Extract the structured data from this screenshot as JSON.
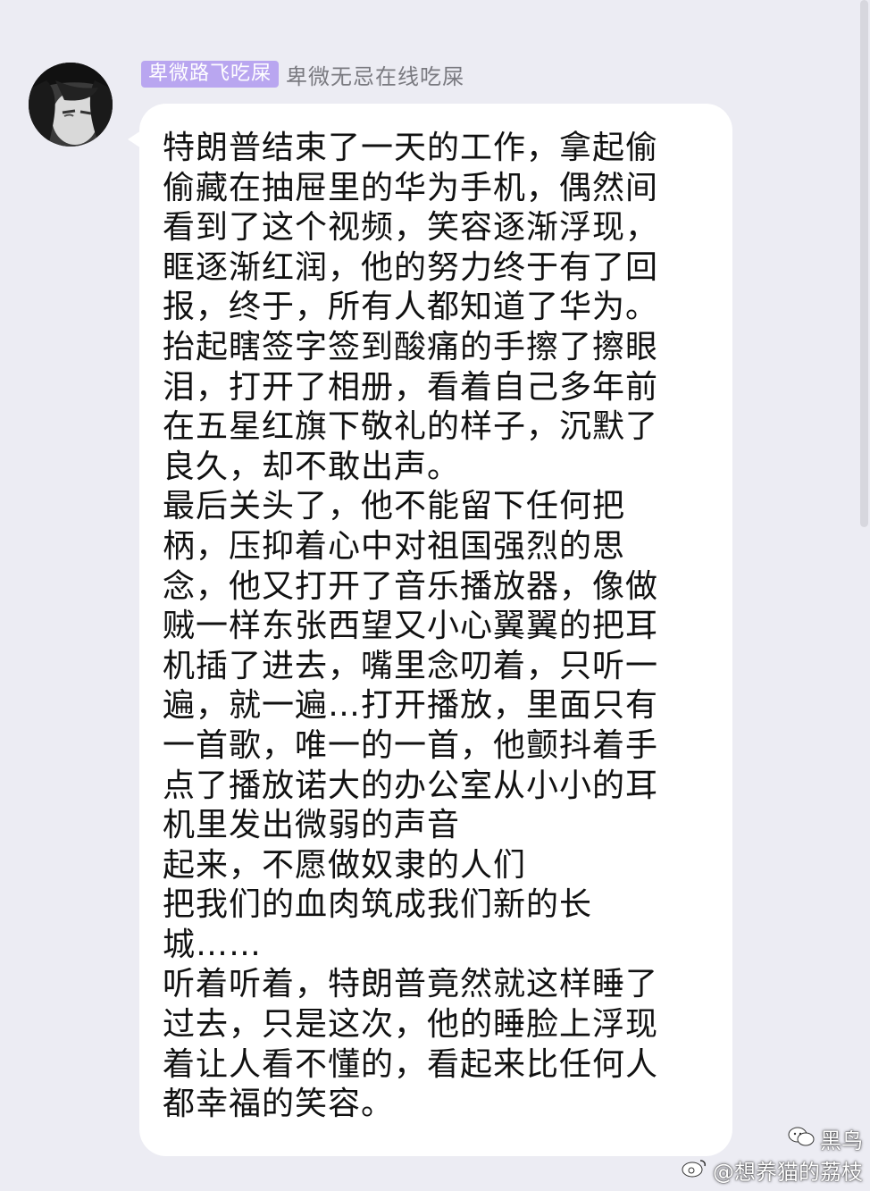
{
  "header": {
    "title_badge": "卑微路飞吃屎",
    "nickname": "卑微无忌在线吃屎"
  },
  "message": {
    "lines": [
      "特朗普结束了一天的工作，拿起偷",
      "偷藏在抽屉里的华为手机，偶然间",
      "看到了这个视频，笑容逐渐浮现，",
      "眶逐渐红润，他的努力终于有了回",
      "报，终于，所有人都知道了华为。",
      "抬起瞎签字签到酸痛的手擦了擦眼",
      "泪，打开了相册，看着自己多年前",
      "在五星红旗下敬礼的样子，沉默了",
      "良久，却不敢出声。",
      "最后关头了，他不能留下任何把",
      "柄，压抑着心中对祖国强烈的思",
      "念，他又打开了音乐播放器，像做",
      "贼一样东张西望又小心翼翼的把耳",
      "机插了进去，嘴里念叨着，只听一",
      "遍，就一遍…打开播放，里面只有",
      "一首歌，唯一的一首，他颤抖着手",
      "点了播放诺大的办公室从小小的耳",
      "机里发出微弱的声音",
      "起来，不愿做奴隶的人们",
      "把我们的血肉筑成我们新的长",
      "城……",
      "听着听着，特朗普竟然就这样睡了",
      "过去，只是这次，他的睡脸上浮现",
      "着让人看不懂的，看起来比任何人",
      "都幸福的笑容。"
    ]
  },
  "watermark": {
    "line1": "黑鸟",
    "line2": "@想养猫的荔枝"
  },
  "colors": {
    "background": "#ececf3",
    "bubble": "#ffffff",
    "badge": "#b9a6f0",
    "nickname": "#7a7a80",
    "text": "#111111"
  },
  "icons": {
    "wechat_watermark": "wechat-icon",
    "weibo_watermark": "weibo-icon"
  }
}
